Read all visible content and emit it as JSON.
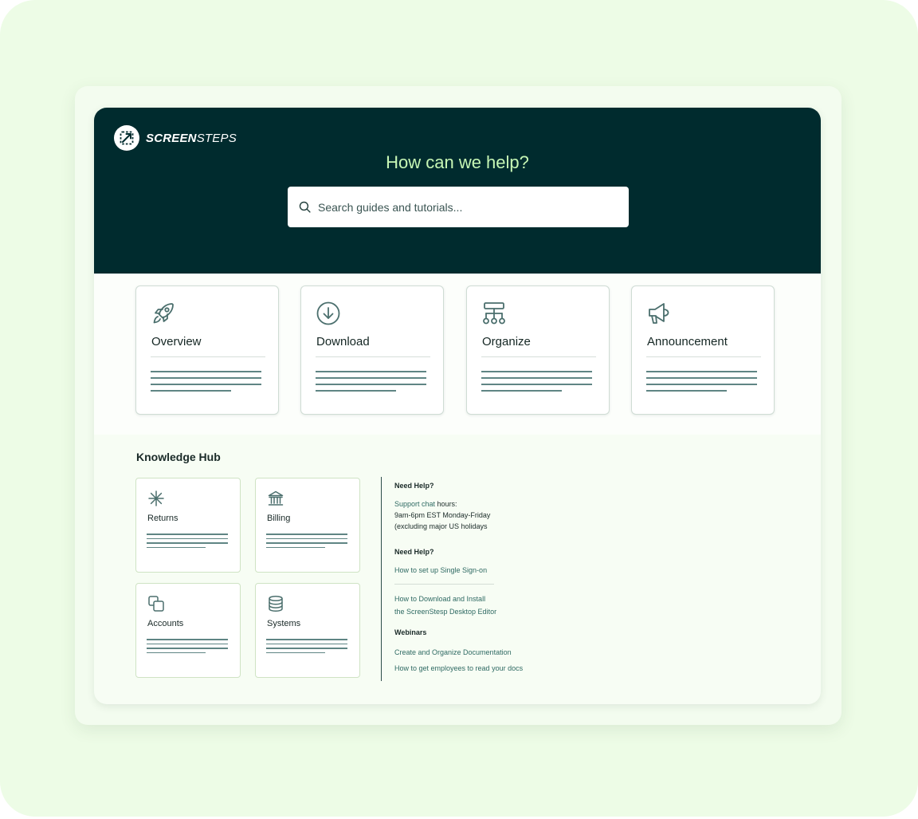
{
  "brand": {
    "name_bold": "SCREEN",
    "name_light": "STEPS"
  },
  "hero": {
    "title": "How can we help?",
    "search_placeholder": "Search guides and tutorials..."
  },
  "categories": [
    {
      "label": "Overview",
      "icon": "rocket-icon"
    },
    {
      "label": "Download",
      "icon": "download-circle-icon"
    },
    {
      "label": "Organize",
      "icon": "sitemap-icon"
    },
    {
      "label": "Announcement",
      "icon": "megaphone-icon"
    }
  ],
  "knowledge_hub": {
    "title": "Knowledge Hub",
    "cards": [
      {
        "label": "Returns",
        "icon": "asterisk-icon"
      },
      {
        "label": "Billing",
        "icon": "bank-icon"
      },
      {
        "label": "Accounts",
        "icon": "copy-icon"
      },
      {
        "label": "Systems",
        "icon": "database-icon"
      }
    ]
  },
  "help": {
    "section1_title": "Need Help?",
    "support_link": "Support chat",
    "support_hours_suffix": " hours:",
    "support_times": "9am-6pm EST Monday-Friday",
    "support_note": "(excluding major US holidays",
    "section2_title": "Need Help?",
    "sso_link": "How to set up Single Sign-on",
    "download_link_line1": "How to Download and Install",
    "download_link_line2": "the ScreenStesp Desktop Editor",
    "section3_title": "Webinars",
    "webinar1": "Create and Organize Documentation",
    "webinar2": "How to get employees to read your docs"
  },
  "colors": {
    "page_bg": "#edfce6",
    "hero_bg": "#002b2e",
    "hero_title": "#c7f7b5",
    "accent_link": "#2f6a63",
    "icon_stroke": "#4b6f6d"
  }
}
